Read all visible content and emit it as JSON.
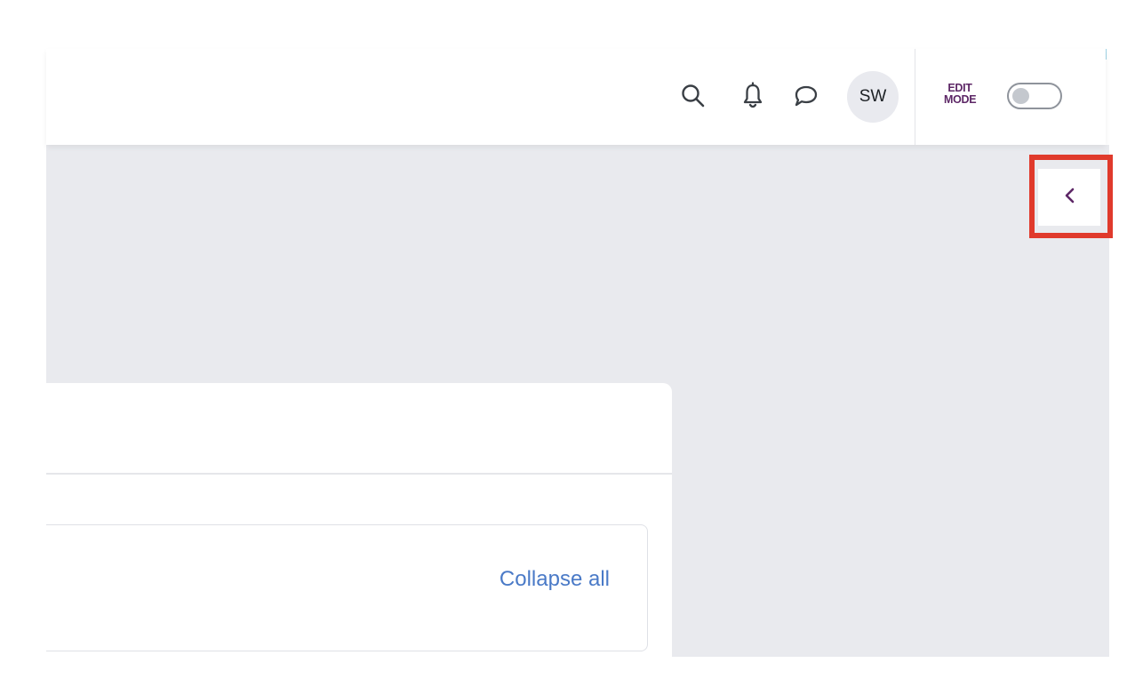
{
  "header": {
    "avatar_initials": "SW",
    "edit_mode_label_line1": "EDIT",
    "edit_mode_label_line2": "MODE",
    "edit_mode_enabled": false,
    "icons": [
      "search-icon",
      "bell-icon",
      "chat-bubble-icon"
    ]
  },
  "drawer": {
    "toggle_icon": "chevron-left-icon"
  },
  "content": {
    "collapse_all_label": "Collapse all"
  },
  "colors": {
    "accent_purple": "#5d2766",
    "link_blue": "#4a7ac7",
    "highlight_red": "#e03a2c",
    "page_gray": "#e9eaee"
  }
}
